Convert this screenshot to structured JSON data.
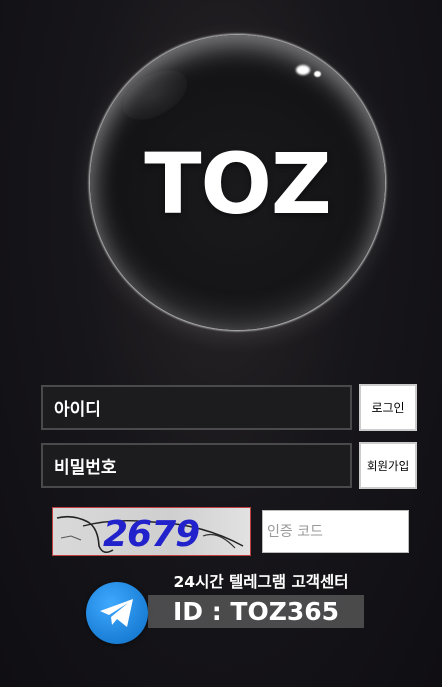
{
  "logo": {
    "text": "TOZ"
  },
  "login_form": {
    "id_placeholder": "아이디",
    "password_placeholder": "비밀번호",
    "login_button": "로그인",
    "signup_button": "회원가입",
    "captcha_code": "2679",
    "captcha_placeholder": "인증 코드"
  },
  "telegram": {
    "title": "24시간 텔레그램 고객센터",
    "id_text": "ID : TOZ365",
    "icon": "telegram-icon",
    "accent_color": "#2a8de0"
  }
}
